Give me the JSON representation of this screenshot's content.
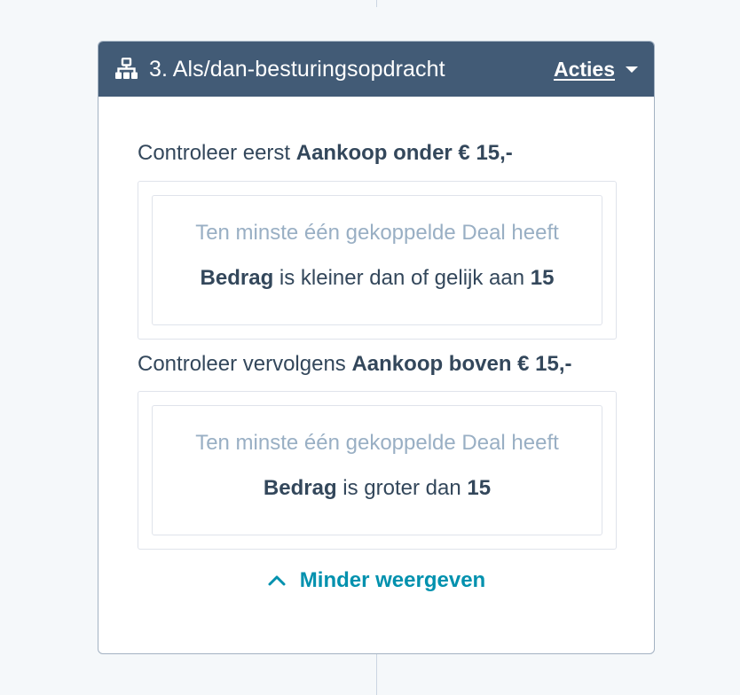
{
  "card": {
    "header": {
      "icon": "workflow-branch-icon",
      "title": "3. Als/dan-besturingsopdracht",
      "actions_label": "Acties",
      "actions_icon": "caret-down-icon"
    },
    "branches": [
      {
        "prefix": "Controleer eerst",
        "name": "Aankoop onder € 15,-",
        "intro": "Ten minste één gekoppelde Deal heeft",
        "property": "Bedrag",
        "operator": "is kleiner dan of gelijk aan",
        "value": "15"
      },
      {
        "prefix": "Controleer vervolgens",
        "name": "Aankoop boven € 15,-",
        "intro": "Ten minste één gekoppelde Deal heeft",
        "property": "Bedrag",
        "operator": "is groter dan",
        "value": "15"
      }
    ],
    "toggle": {
      "icon": "chevron-up-icon",
      "label": "Minder weergeven"
    }
  },
  "colors": {
    "header_bg": "#425b76",
    "text_primary": "#33475b",
    "text_muted": "#99afc4",
    "link": "#0091ae",
    "page_bg": "#f5f8fa",
    "border": "#dfe3eb"
  }
}
